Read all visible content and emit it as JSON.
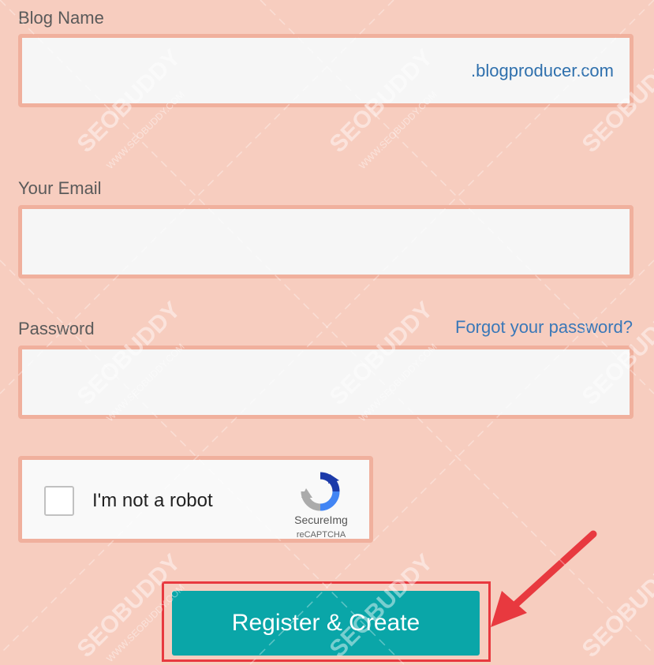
{
  "form": {
    "blog_name_label": "Blog Name",
    "blog_name_value": "",
    "blog_domain_suffix": ".blogproducer.com",
    "email_label": "Your Email",
    "email_value": "",
    "password_label": "Password",
    "password_value": "",
    "forgot_password_link": "Forgot your password?",
    "register_button": "Register & Create"
  },
  "captcha": {
    "checkbox_label": "I'm not a robot",
    "checked": false,
    "brand": "SecureImg",
    "sub": "reCAPTCHA",
    "icon": "recaptcha-logo-icon"
  },
  "watermark": {
    "text": "SEOBUDDY",
    "subtext": "WWW.SEOBUDDY.COM"
  },
  "colors": {
    "background": "#f7cdbf",
    "field_border": "#f0b09d",
    "button": "#0aa6a8",
    "highlight": "#e8393f",
    "link": "#3a78b8"
  }
}
